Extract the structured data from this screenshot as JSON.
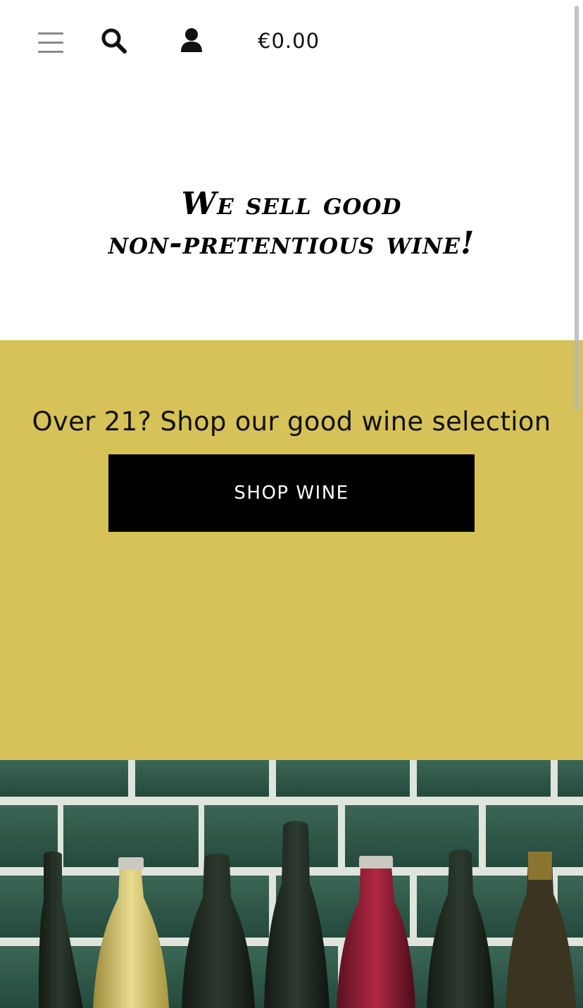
{
  "header": {
    "menu_icon": "hamburger-menu-icon",
    "search_icon": "search-icon",
    "account_icon": "user-account-icon",
    "cart_total": "€0.00"
  },
  "hero": {
    "tagline_line1": "We sell good",
    "tagline_line2": "non-pretentious wine!"
  },
  "promo": {
    "text": "Over 21? Shop our good wine selection",
    "button_label": "SHOP WINE",
    "background_color": "#d6c258"
  },
  "banner_image": {
    "subject": "row of wine bottles in front of green tile wall"
  }
}
